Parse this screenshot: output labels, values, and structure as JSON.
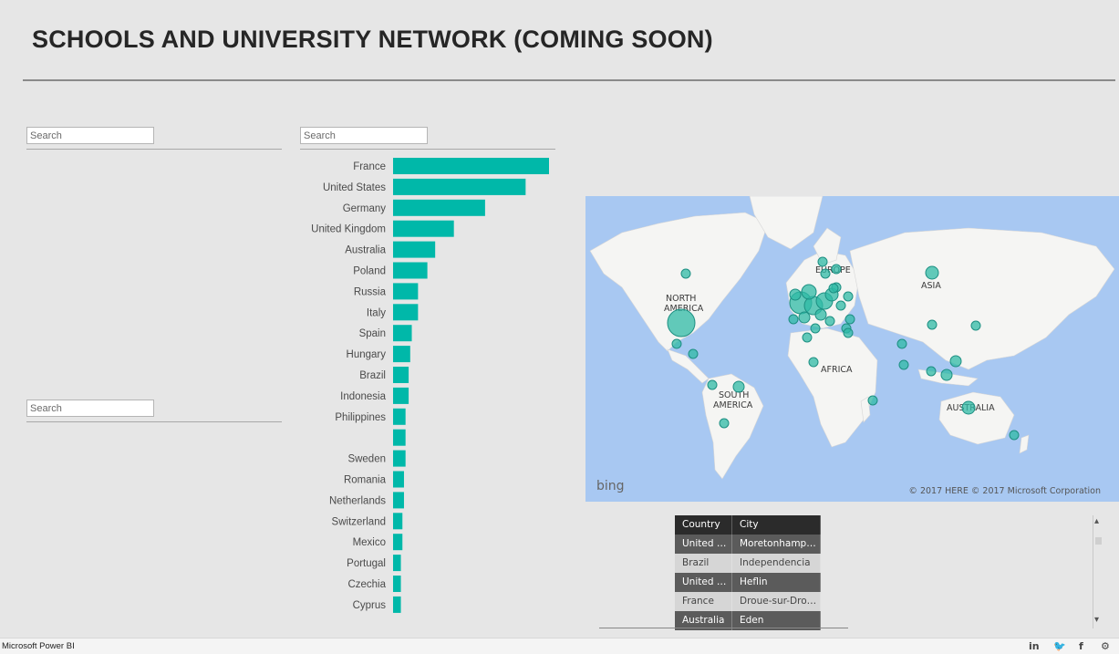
{
  "header": {
    "title": "SCHOOLS AND UNIVERSITY NETWORK (COMING SOON)"
  },
  "slicers": [
    {
      "placeholder": "Search"
    },
    {
      "placeholder": "Search"
    },
    {
      "placeholder": "Search"
    }
  ],
  "colors": {
    "bar": "#00b8a9",
    "bubble": "#2fb9a6",
    "map_water": "#a8c8f2",
    "map_land": "#f5f5f3"
  },
  "chart_data": {
    "type": "bar",
    "orientation": "horizontal",
    "categories": [
      "France",
      "United States",
      "Germany",
      "United Kingdom",
      "Australia",
      "Poland",
      "Russia",
      "Italy",
      "Spain",
      "Hungary",
      "Brazil",
      "Indonesia",
      "Philippines",
      "",
      "Sweden",
      "Romania",
      "Netherlands",
      "Switzerland",
      "Mexico",
      "Portugal",
      "Czechia",
      "Cyprus"
    ],
    "values": [
      100,
      85,
      59,
      39,
      27,
      22,
      16,
      16,
      12,
      11,
      10,
      10,
      8,
      8,
      8,
      7,
      7,
      6,
      6,
      5,
      5,
      5
    ],
    "xlabel": "",
    "ylabel": "",
    "grid": false
  },
  "map": {
    "labels": {
      "north_america": "NORTH",
      "north_america_2": "AMERICA",
      "south_america": "SOUTH",
      "south_america_2": "AMERICA",
      "europe": "EUROPE",
      "asia": "ASIA",
      "africa": "AFRICA",
      "australia": "AUSTRALIA"
    },
    "provider": "bing",
    "credit": "© 2017 HERE    © 2017 Microsoft Corporation"
  },
  "table": {
    "columns": [
      "Country",
      "City"
    ],
    "rows": [
      {
        "country": "United Ki...",
        "city": "Moretonhampst..."
      },
      {
        "country": "Brazil",
        "city": "Independencia"
      },
      {
        "country": "United St...",
        "city": "Heflin"
      },
      {
        "country": "France",
        "city": "Droue-sur-Droue..."
      },
      {
        "country": "Australia",
        "city": "Eden"
      }
    ]
  },
  "footer": {
    "brand": "Microsoft Power BI",
    "social": {
      "linkedin": "in",
      "twitter": "🐦",
      "facebook": "f"
    }
  }
}
